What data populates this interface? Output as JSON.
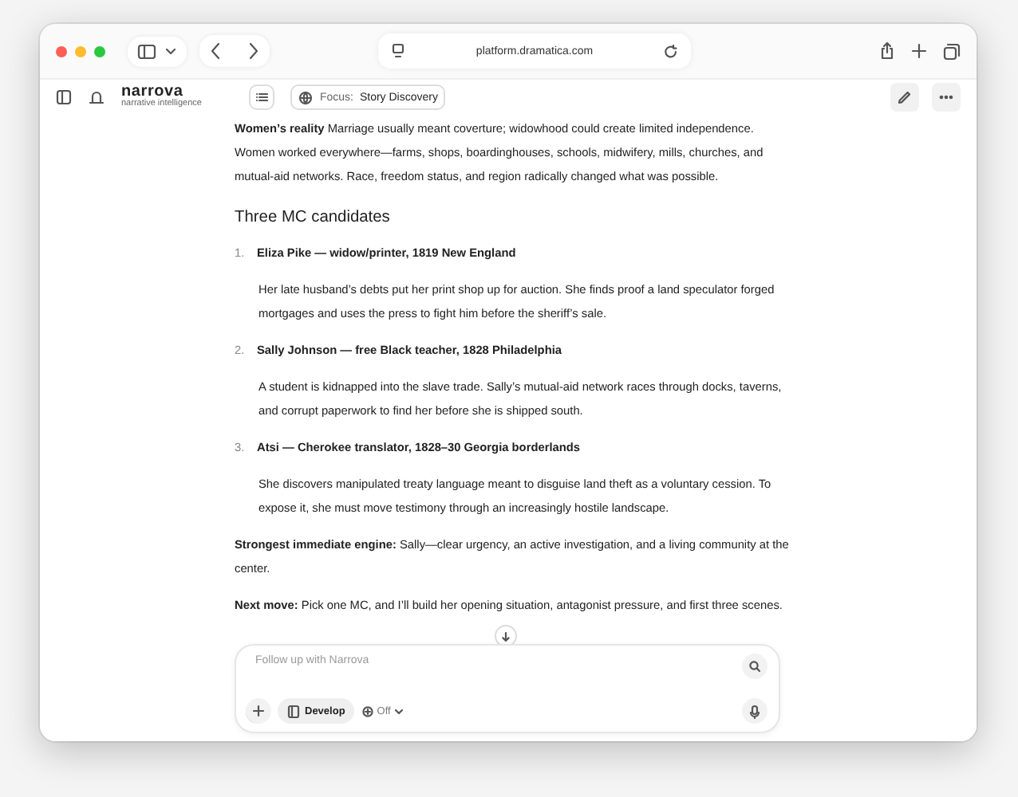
{
  "browser": {
    "url": "platform.dramatica.com"
  },
  "app": {
    "name": "narrova",
    "tagline": "narrative intelligence",
    "focus_label": "Focus:",
    "focus_value": "Story Discovery"
  },
  "message": {
    "intro": "**Women’s reality** Marriage usually meant coverture; widowhood could create limited independence. Women worked everywhere—farms, shops, boardinghouses, schools, midwifery, mills, churches, and mutual-aid networks. Race, freedom status, and region radically changed what was possible.",
    "heading": "Three MC candidates",
    "candidates": [
      {
        "number": "1.",
        "title": "Eliza Pike — widow/printer, 1819 New England",
        "body": "Her late husband’s debts put her print shop up for auction. She finds proof a land speculator forged mortgages and uses the press to fight him before the sheriff’s sale."
      },
      {
        "number": "2.",
        "title": "Sally Johnson — free Black teacher, 1828 Philadelphia",
        "body": "A student is kidnapped into the slave trade. Sally’s mutual-aid network races through docks, taverns, and corrupt paperwork to find her before she is shipped south."
      },
      {
        "number": "3.",
        "title": "Atsi — Cherokee translator, 1828–30 Georgia borderlands",
        "body": "She discovers manipulated treaty language meant to disguise land theft as a voluntary cession. To expose it, she must move testimony through an increasingly hostile landscape."
      }
    ],
    "closing": [
      "**Strongest immediate engine:** Sally—clear urgency, an active investigation, and a living community at the center.",
      "**Next move:** Pick one MC, and I’ll build her opening situation, antagonist pressure, and first three scenes."
    ]
  },
  "composer": {
    "placeholder": "Follow up with Narrova",
    "mode": "Develop",
    "toggle": "Off"
  }
}
